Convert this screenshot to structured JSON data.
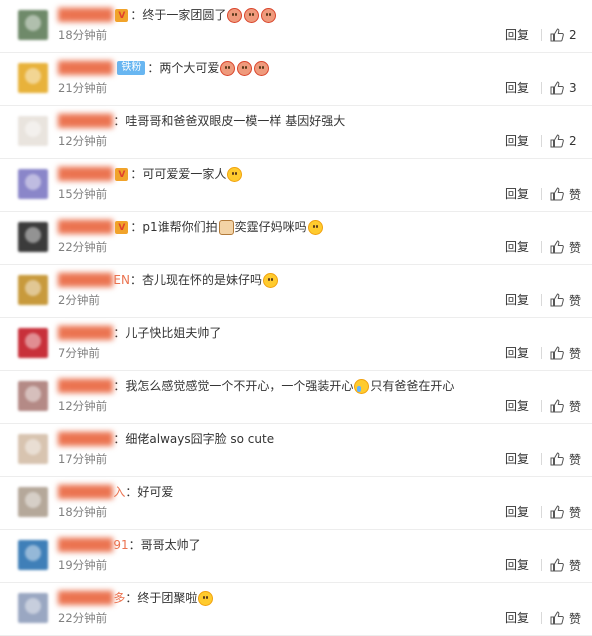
{
  "actions": {
    "reply_label": "回复"
  },
  "comments": [
    {
      "avatar_color": "#6f8a6a",
      "name_tail": "",
      "badge": "",
      "crown": true,
      "text": "：终于一家团圆了",
      "emojis": [
        "red",
        "red",
        "red"
      ],
      "text_after": "",
      "time": "18分钟前",
      "likes": "2"
    },
    {
      "avatar_color": "#e8b23b",
      "name_tail": "",
      "badge": "铁粉",
      "crown": false,
      "text": "：两个大可爱",
      "emojis": [
        "red",
        "red",
        "red"
      ],
      "text_after": "",
      "time": "21分钟前",
      "likes": "3"
    },
    {
      "avatar_color": "#e9e4de",
      "name_tail": "",
      "badge": "",
      "crown": false,
      "text": "：哇哥哥和爸爸双眼皮一模一样 基因好强大",
      "emojis": [],
      "text_after": "",
      "time": "12分钟前",
      "likes": "2"
    },
    {
      "avatar_color": "#8a86c9",
      "name_tail": "",
      "badge": "",
      "crown": true,
      "text": "：可可爱爱一家人",
      "emojis": [
        "yellow"
      ],
      "text_after": "",
      "time": "15分钟前",
      "likes": "赞"
    },
    {
      "avatar_color": "#3b3b3b",
      "name_tail": "",
      "badge": "",
      "crown": true,
      "text": "：p1谁帮你们拍",
      "emojis": [
        "cat"
      ],
      "text_after": "奕霆仔妈咪吗",
      "emojis_after": [
        "yellow"
      ],
      "time": "22分钟前",
      "likes": "赞"
    },
    {
      "avatar_color": "#c89a3c",
      "name_tail": "EN",
      "badge": "",
      "crown": false,
      "text": "：杏儿现在怀的是妹仔吗",
      "emojis": [
        "yellow"
      ],
      "text_after": "",
      "time": "2分钟前",
      "likes": "赞"
    },
    {
      "avatar_color": "#c8303a",
      "name_tail": "",
      "badge": "",
      "crown": false,
      "text": "：儿子快比姐夫帅了",
      "emojis": [],
      "text_after": "",
      "time": "7分钟前",
      "likes": "赞"
    },
    {
      "avatar_color": "#b48a86",
      "name_tail": "",
      "badge": "",
      "crown": false,
      "text": "：我怎么感觉感觉一个不开心，一个强装开心",
      "emojis": [
        "crying"
      ],
      "text_after": "只有爸爸在开心",
      "emojis_after": [],
      "time": "12分钟前",
      "likes": "赞"
    },
    {
      "avatar_color": "#d8c4b0",
      "name_tail": "",
      "badge": "",
      "crown": false,
      "text": "：细佬always囧字脸 so cute",
      "emojis": [],
      "text_after": "",
      "time": "17分钟前",
      "likes": "赞"
    },
    {
      "avatar_color": "#b5a89a",
      "name_tail": "入",
      "badge": "",
      "crown": false,
      "text": "：好可爱",
      "emojis": [],
      "text_after": "",
      "time": "18分钟前",
      "likes": "赞"
    },
    {
      "avatar_color": "#3f7fb8",
      "name_tail": "91",
      "badge": "",
      "crown": false,
      "text": "：哥哥太帅了",
      "emojis": [],
      "text_after": "",
      "time": "19分钟前",
      "likes": "赞"
    },
    {
      "avatar_color": "#9aa7c2",
      "name_tail": "多",
      "badge": "",
      "crown": false,
      "text": "：终于团聚啦",
      "emojis": [
        "yellow"
      ],
      "text_after": "",
      "time": "22分钟前",
      "likes": "赞"
    }
  ]
}
